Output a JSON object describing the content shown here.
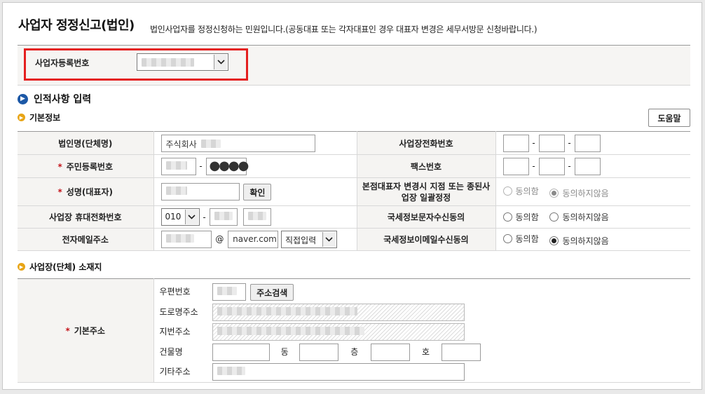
{
  "title": "사업자 정정신고(법인)",
  "subtitle": "법인사업자를 정정신청하는 민원입니다.(공동대표 또는 각자대표인 경우 대표자 변경은 세무서방문 신청바랍니다.)",
  "biz_reg": {
    "label": "사업자등록번호"
  },
  "section_main": "인적사항 입력",
  "basic_info": {
    "title": "기본정보",
    "help_button": "도움말",
    "corp_name_label": "법인명(단체명)",
    "corp_name_value": "주식회사",
    "biz_phone_label": "사업장전화번호",
    "resident_no_label": "주민등록번호",
    "fax_label": "팩스번호",
    "name_label": "성명(대표자)",
    "confirm_button": "확인",
    "rep_change_label": "본점대표자 변경시 지점 또는 종된사업장 일괄정정",
    "mobile_label": "사업장 휴대전화번호",
    "mobile_prefix": "010",
    "sms_consent_label": "국세정보문자수신동의",
    "email_label": "전자메일주소",
    "email_at": "@",
    "email_domain": "naver.com",
    "email_select": "직접입력",
    "email_consent_label": "국세정보이메일수신동의",
    "agree": "동의함",
    "disagree": "동의하지않음",
    "req_mark": "*"
  },
  "location": {
    "title": "사업장(단체) 소재지",
    "basic_addr_label": "기본주소",
    "zip_label": "우편번호",
    "addr_search_button": "주소검색",
    "road_addr_label": "도로명주소",
    "lot_addr_label": "지번주소",
    "building_label": "건물명",
    "dong_label": "동",
    "floor_label": "층",
    "ho_label": "호",
    "etc_addr_label": "기타주소"
  },
  "colors": {
    "required": "#c4161c",
    "highlight": "#e41f1f",
    "section_icon": "#1c58a6",
    "sub_icon": "#e8a516"
  }
}
